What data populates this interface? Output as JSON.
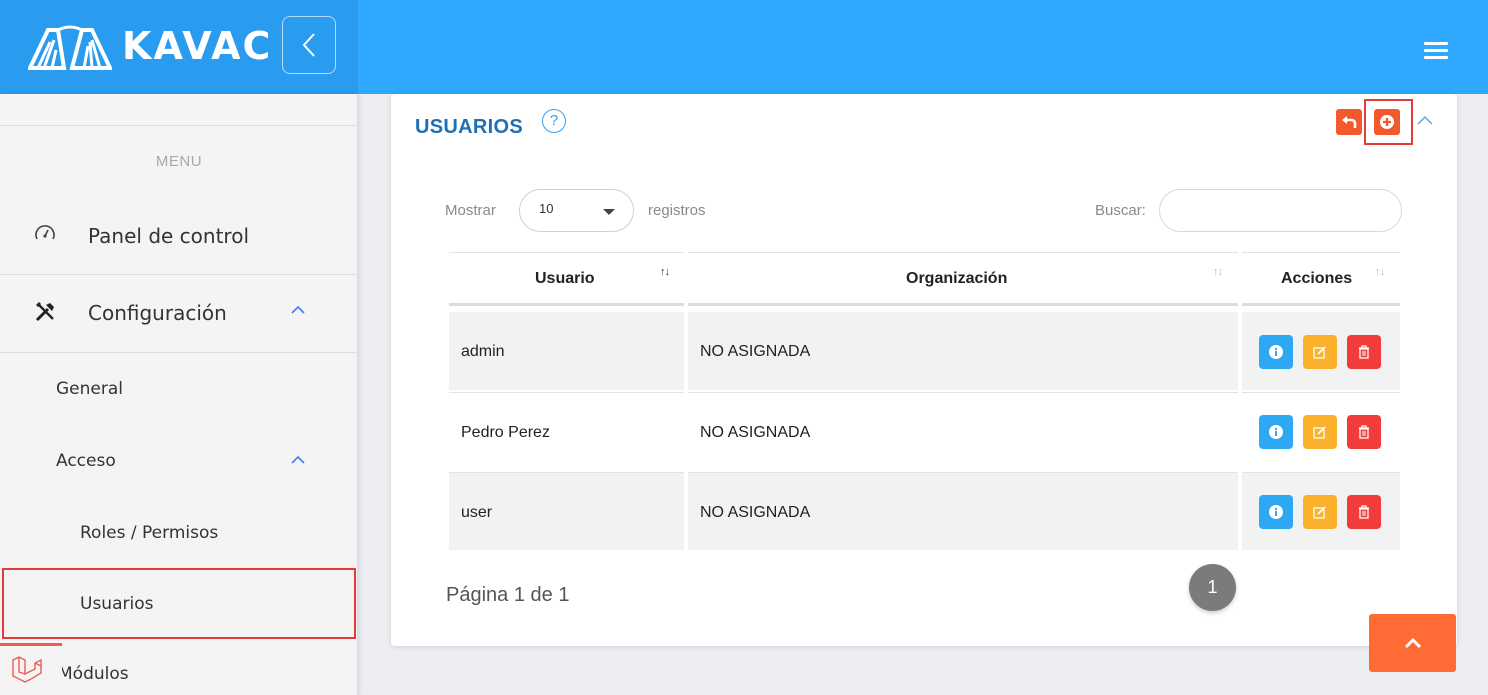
{
  "brand": {
    "name": "KAVAC"
  },
  "sidebar": {
    "menu_label": "MENU",
    "items": [
      {
        "label": "Panel de control",
        "icon": "dashboard-icon"
      },
      {
        "label": "Configuración",
        "icon": "tools-icon",
        "expanded": true
      },
      {
        "label": "General"
      },
      {
        "label": "Acceso",
        "expanded": true
      },
      {
        "label": "Roles / Permisos"
      },
      {
        "label": "Usuarios",
        "active": true
      },
      {
        "label": "Módulos",
        "icon": "laravel-icon"
      }
    ]
  },
  "panel": {
    "title": "USUARIOS",
    "help_symbol": "?",
    "length": {
      "prefix": "Mostrar",
      "value": "10",
      "suffix": "registros"
    },
    "search": {
      "label": "Buscar:",
      "value": "",
      "placeholder": ""
    },
    "table": {
      "columns": [
        "Usuario",
        "Organización",
        "Acciones"
      ],
      "sort_symbol": "↑↓",
      "rows": [
        {
          "usuario": "admin",
          "organizacion": "NO ASIGNADA"
        },
        {
          "usuario": "Pedro Perez",
          "organizacion": "NO ASIGNADA"
        },
        {
          "usuario": "user",
          "organizacion": "NO ASIGNADA"
        }
      ]
    },
    "pagination": {
      "text": "Página 1 de 1",
      "current_page": "1"
    }
  },
  "colors": {
    "topbar": "#30a8ff",
    "title": "#1e6fb5",
    "info": "#2ea8f5",
    "edit": "#fbb12a",
    "delete": "#f23b3b",
    "accent": "#ff6b35"
  }
}
